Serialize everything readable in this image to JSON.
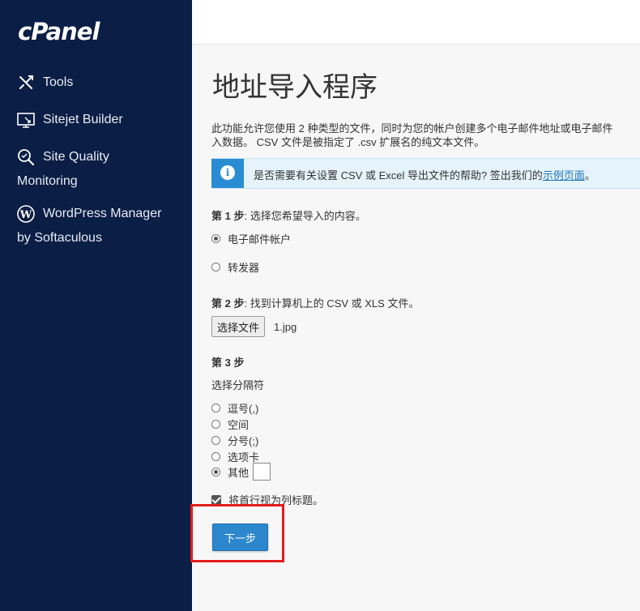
{
  "sidebar": {
    "logo": "cPanel",
    "items": [
      {
        "label": "Tools",
        "icon": "tools-icon"
      },
      {
        "label": "Sitejet Builder",
        "icon": "sitejet-icon"
      },
      {
        "label_line1": "Site Quality",
        "label_line2": "Monitoring",
        "icon": "magnifier-icon"
      },
      {
        "label_line1": "WordPress Manager",
        "label_line2": "by Softaculous",
        "icon": "wordpress-icon"
      }
    ]
  },
  "main": {
    "title": "地址导入程序",
    "description_line1": "此功能允许您使用 2 种类型的文件，同时为您的帐户创建多个电子邮件地址或电子邮件",
    "description_line2": "入数据。 CSV 文件是被指定了 .csv 扩展名的纯文本文件。",
    "info": {
      "text": "是否需要有关设置 CSV 或 Excel 导出文件的帮助? 签出我们的",
      "link": "示例页面",
      "suffix": "。"
    },
    "step1": {
      "label_bold": "第 1 步",
      "label_rest": ": 选择您希望导入的内容。",
      "options": [
        "电子邮件帐户",
        "转发器"
      ],
      "selected": "电子邮件帐户"
    },
    "step2": {
      "label_bold": "第 2 步",
      "label_rest": ": 找到计算机上的 CSV 或 XLS 文件。",
      "file_button": "选择文件",
      "file_name": "1.jpg"
    },
    "step3": {
      "label_bold": "第 3 步",
      "sublabel": "选择分隔符",
      "options": [
        "逗号(,)",
        "空间",
        "分号(;)",
        "选项卡",
        "其他"
      ],
      "selected": "其他",
      "checkbox_label": "将首行视为列标题。",
      "checkbox_checked": true
    },
    "next_button": "下一步"
  },
  "colors": {
    "sidebar_bg": "#0b1e45",
    "accent_blue": "#2c87cc",
    "highlight_red": "#e31c1c",
    "info_bg": "#e5f3fb"
  }
}
